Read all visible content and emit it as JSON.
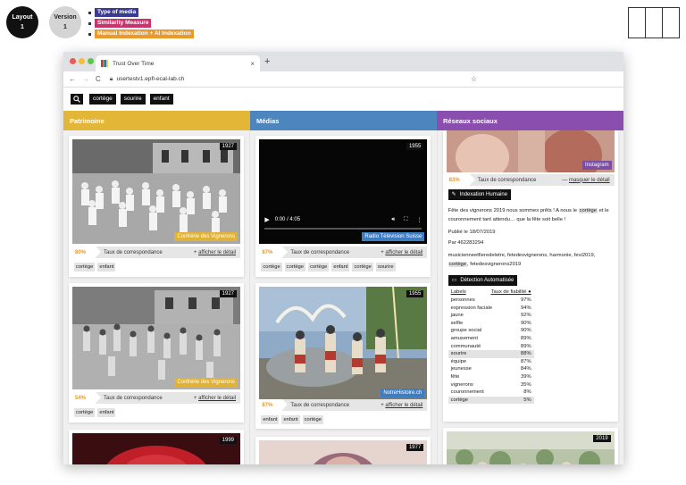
{
  "annotations": {
    "layout_label": "Layout",
    "layout_value": "1",
    "version_label": "Version",
    "version_value": "1",
    "legend": [
      {
        "label": "Type of media",
        "color": "#3a3a93"
      },
      {
        "label": "Similarity Measure",
        "color": "#c6356b"
      },
      {
        "label": "Manual Indexation + AI Indexation",
        "color": "#e89a2c"
      }
    ]
  },
  "browser": {
    "tab_title": "Trust Over Time",
    "url": "usertestv1.epfl-ecal-lab.ch",
    "nav": {
      "back": "←",
      "forward": "→",
      "reload": "C",
      "new_tab": "+",
      "close": "×",
      "star": "☆",
      "lock": "🔒"
    }
  },
  "search": {
    "icon": "search-icon",
    "terms": [
      "cortège",
      "sourire",
      "enfant"
    ]
  },
  "colors": {
    "patrimoine": "#e3b637",
    "medias": "#4d86bf",
    "reseaux": "#8a4fae",
    "score": "#e39b2d",
    "caption_patrimoine": "#e0b238",
    "caption_medias": "#3f7cc0",
    "caption_instagram": "#7a4fa0"
  },
  "columns": [
    {
      "title": "Patrimoine"
    },
    {
      "title": "Médias"
    },
    {
      "title": "Réseaux sociaux"
    }
  ],
  "score_label": "Taux de correspondance",
  "show_detail": "afficher le détail",
  "hide_detail": "masquer le détail",
  "patrimoine": [
    {
      "year": "1927",
      "caption": "Confrérie des Vignerons",
      "score": "80%",
      "tags": [
        "cortège",
        "enfant"
      ]
    },
    {
      "year": "1927",
      "caption": "Confrérie des Vignerons",
      "score": "54%",
      "tags": [
        "cortège",
        "enfant"
      ]
    },
    {
      "year": "1999"
    }
  ],
  "medias": [
    {
      "year": "1955",
      "caption": "Radio Télévision Suisse",
      "score": "87%",
      "video_time": "0:00 / 4:05",
      "tags": [
        "cortège",
        "cortège",
        "cortège",
        "enfant",
        "cortège",
        "sourire"
      ]
    },
    {
      "year": "1955",
      "caption": "NotreHistoire.ch",
      "score": "87%",
      "tags": [
        "enfant",
        "enfant",
        "cortège"
      ]
    },
    {
      "year": "1977"
    }
  ],
  "reseaux": {
    "post": {
      "caption": "Instagram",
      "score": "83%",
      "human_index_label": "Indexation Humaine",
      "text_before": "Fête des vignerons 2019 nous sommes prêts ! A nous le",
      "text_hl": "cortège",
      "text_after": "et le couronnement tant attendu… que la fête soit belle !",
      "published": "Publié le 18/07/2019",
      "author": "Par 462283294",
      "hashtags_before": "musicienneetfieredeletre, fetedesvignerons, harmonie, fevi2019,",
      "hashtags_hl": "cortège",
      "hashtags_after": ", fetedesvignerons2019",
      "auto_detect_label": "Détection Automatisée",
      "labels_header": "Labels",
      "rate_header": "Taux de fiabilité",
      "labels": [
        {
          "name": "personnes",
          "rate": "97%"
        },
        {
          "name": "expression faciale",
          "rate": "94%"
        },
        {
          "name": "jaune",
          "rate": "92%"
        },
        {
          "name": "selfie",
          "rate": "90%"
        },
        {
          "name": "groupe social",
          "rate": "90%"
        },
        {
          "name": "amusement",
          "rate": "89%"
        },
        {
          "name": "communauté",
          "rate": "89%"
        },
        {
          "name": "sourire",
          "rate": "88%",
          "highlight": true
        },
        {
          "name": "équipe",
          "rate": "87%"
        },
        {
          "name": "jeunesse",
          "rate": "84%"
        },
        {
          "name": "fête",
          "rate": "39%"
        },
        {
          "name": "vignerons",
          "rate": "35%"
        },
        {
          "name": "couronnement",
          "rate": "8%"
        },
        {
          "name": "cortège",
          "rate": "5%",
          "highlight": true
        }
      ]
    },
    "next": {
      "year": "2019"
    }
  }
}
